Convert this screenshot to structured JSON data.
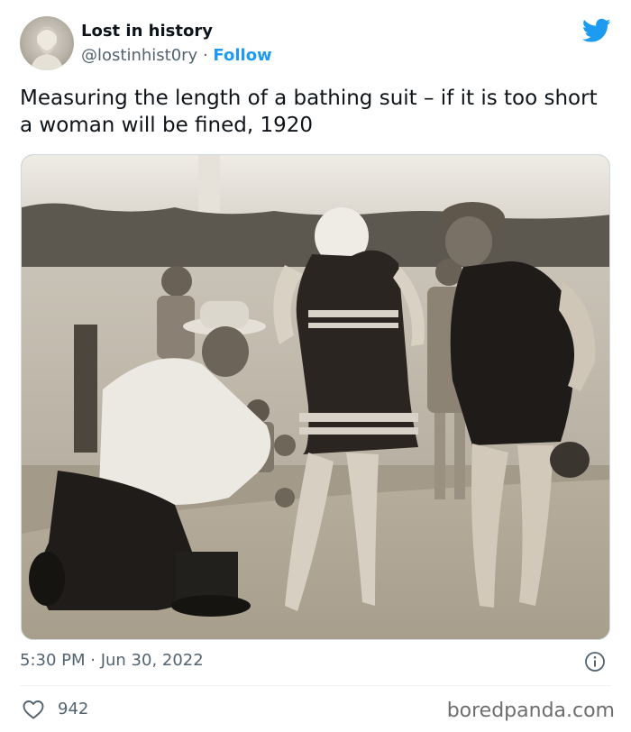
{
  "user": {
    "display_name": "Lost in history",
    "handle": "@lostinhist0ry",
    "separator": "·",
    "follow_label": "Follow"
  },
  "tweet": {
    "text": "Measuring the length of a bathing suit – if it is too short a woman will be fined, 1920",
    "timestamp": "5:30 PM · Jun 30, 2022",
    "likes": "942"
  },
  "icons": {
    "platform": "twitter-bird-icon",
    "info": "info-icon",
    "like": "heart-icon"
  },
  "watermark": "boredpanda.com",
  "colors": {
    "accent": "#1d9bf0",
    "secondary_text": "#536471",
    "primary_text": "#0f1419"
  }
}
